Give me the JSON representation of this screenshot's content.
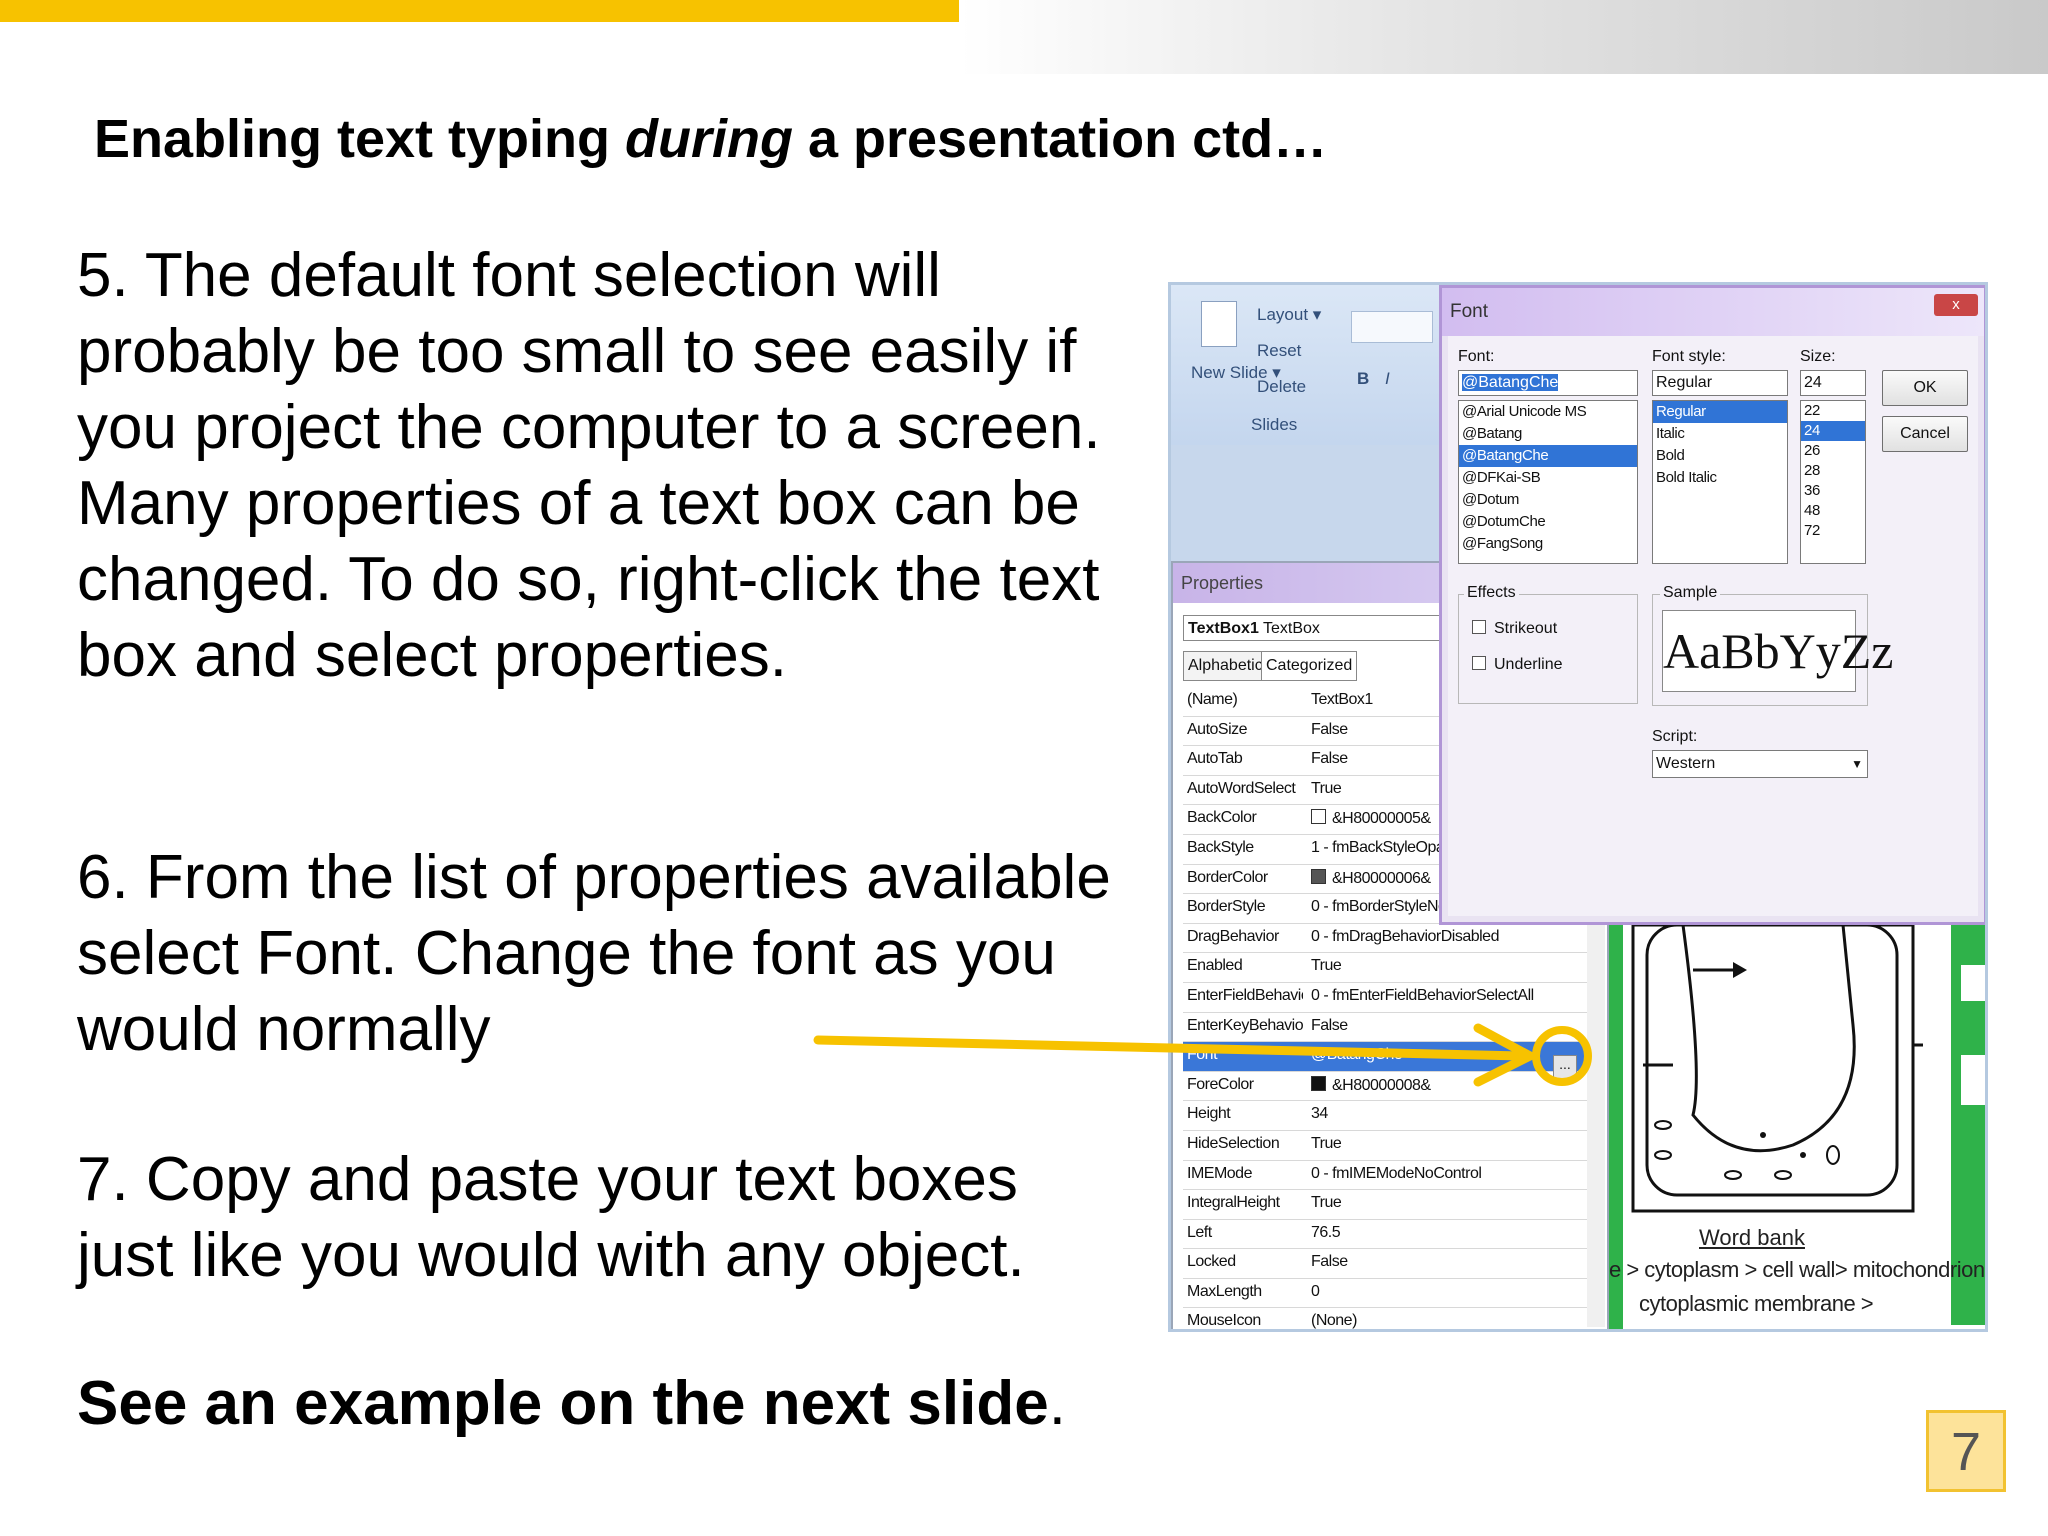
{
  "slide": {
    "title_pre": "Enabling text typing ",
    "title_em": "during",
    "title_post": " a presentation ctd…",
    "para5": "5. The default font selection will probably be too small to see easily if you project the computer to a screen. Many properties of a text box can be changed. To do so, right-click the text box and select properties.",
    "para6": "6. From the list of properties available select Font. Change the font as you would normally",
    "para7": "7. Copy and paste your text boxes just like you would with any object.",
    "para8_bold": "See an example on the next slide",
    "para8_end": ".",
    "page_number": "7",
    "accent_color": "#f7c200"
  },
  "ribbon": {
    "layout": "Layout ▾",
    "reset": "Reset",
    "new_slide": "New Slide ▾",
    "delete": "Delete",
    "group": "Slides",
    "bold": "B",
    "italic": "I"
  },
  "properties": {
    "title": "Properties",
    "object": "TextBox1",
    "object_type": "TextBox",
    "tab_alpha": "Alphabetic",
    "tab_cat": "Categorized",
    "rows": [
      {
        "name": "(Name)",
        "value": "TextBox1"
      },
      {
        "name": "AutoSize",
        "value": "False"
      },
      {
        "name": "AutoTab",
        "value": "False"
      },
      {
        "name": "AutoWordSelect",
        "value": "True"
      },
      {
        "name": "BackColor",
        "value": "&H80000005&"
      },
      {
        "name": "BackStyle",
        "value": "1 - fmBackStyleOpaque"
      },
      {
        "name": "BorderColor",
        "value": "&H80000006&"
      },
      {
        "name": "BorderStyle",
        "value": "0 - fmBorderStyleNone"
      },
      {
        "name": "DragBehavior",
        "value": "0 - fmDragBehaviorDisabled"
      },
      {
        "name": "Enabled",
        "value": "True"
      },
      {
        "name": "EnterFieldBehavior",
        "value": "0 - fmEnterFieldBehaviorSelectAll"
      },
      {
        "name": "EnterKeyBehavior",
        "value": "False"
      },
      {
        "name": "Font",
        "value": "@BatangChe"
      },
      {
        "name": "ForeColor",
        "value": "&H80000008&"
      },
      {
        "name": "Height",
        "value": "34"
      },
      {
        "name": "HideSelection",
        "value": "True"
      },
      {
        "name": "IMEMode",
        "value": "0 - fmIMEModeNoControl"
      },
      {
        "name": "IntegralHeight",
        "value": "True"
      },
      {
        "name": "Left",
        "value": "76.5"
      },
      {
        "name": "Locked",
        "value": "False"
      },
      {
        "name": "MaxLength",
        "value": "0"
      },
      {
        "name": "MouseIcon",
        "value": "(None)"
      }
    ],
    "ellipsis": "..."
  },
  "font_dialog": {
    "title": "Font",
    "close": "x",
    "font_label": "Font:",
    "font_value": "@BatangChe",
    "fonts": [
      "@Arial Unicode MS",
      "@Batang",
      "@BatangChe",
      "@DFKai-SB",
      "@Dotum",
      "@DotumChe",
      "@FangSong"
    ],
    "style_label": "Font style:",
    "style_value": "Regular",
    "styles": [
      "Regular",
      "Italic",
      "Bold",
      "Bold Italic"
    ],
    "size_label": "Size:",
    "size_value": "24",
    "sizes": [
      "22",
      "24",
      "26",
      "28",
      "36",
      "48",
      "72"
    ],
    "ok": "OK",
    "cancel": "Cancel",
    "effects_label": "Effects",
    "strikeout": "Strikeout",
    "underline": "Underline",
    "sample_label": "Sample",
    "sample_text": "AaBbYyZz",
    "script_label": "Script:",
    "script_value": "Western"
  },
  "word_bank": {
    "title": "Word bank",
    "line1": "e > cytoplasm > cell wall> mitochondrion :",
    "line2": "cytoplasmic membrane >"
  }
}
